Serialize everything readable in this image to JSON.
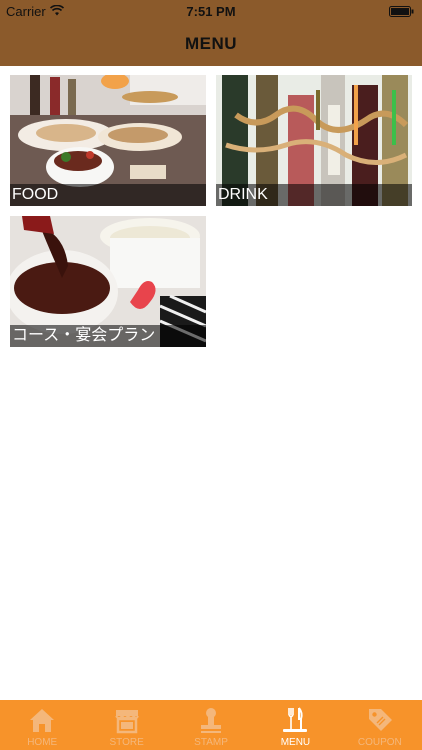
{
  "status": {
    "carrier": "Carrier",
    "time": "7:51 PM"
  },
  "header": {
    "title": "MENU"
  },
  "menu": {
    "items": [
      {
        "label": "FOOD"
      },
      {
        "label": "DRINK"
      },
      {
        "label": "コース・宴会プラン"
      }
    ]
  },
  "tabbar": {
    "tabs": [
      {
        "label": "HOME",
        "icon": "home-icon"
      },
      {
        "label": "STORE",
        "icon": "store-icon"
      },
      {
        "label": "STAMP",
        "icon": "stamp-icon"
      },
      {
        "label": "MENU",
        "icon": "menu-icon"
      },
      {
        "label": "COUPON",
        "icon": "coupon-icon"
      }
    ],
    "active": "MENU"
  },
  "colors": {
    "header_bg": "#8b5a2b",
    "tabbar_bg": "#f7932a",
    "tab_inactive": "#f4b77b",
    "tab_active": "#ffffff"
  }
}
